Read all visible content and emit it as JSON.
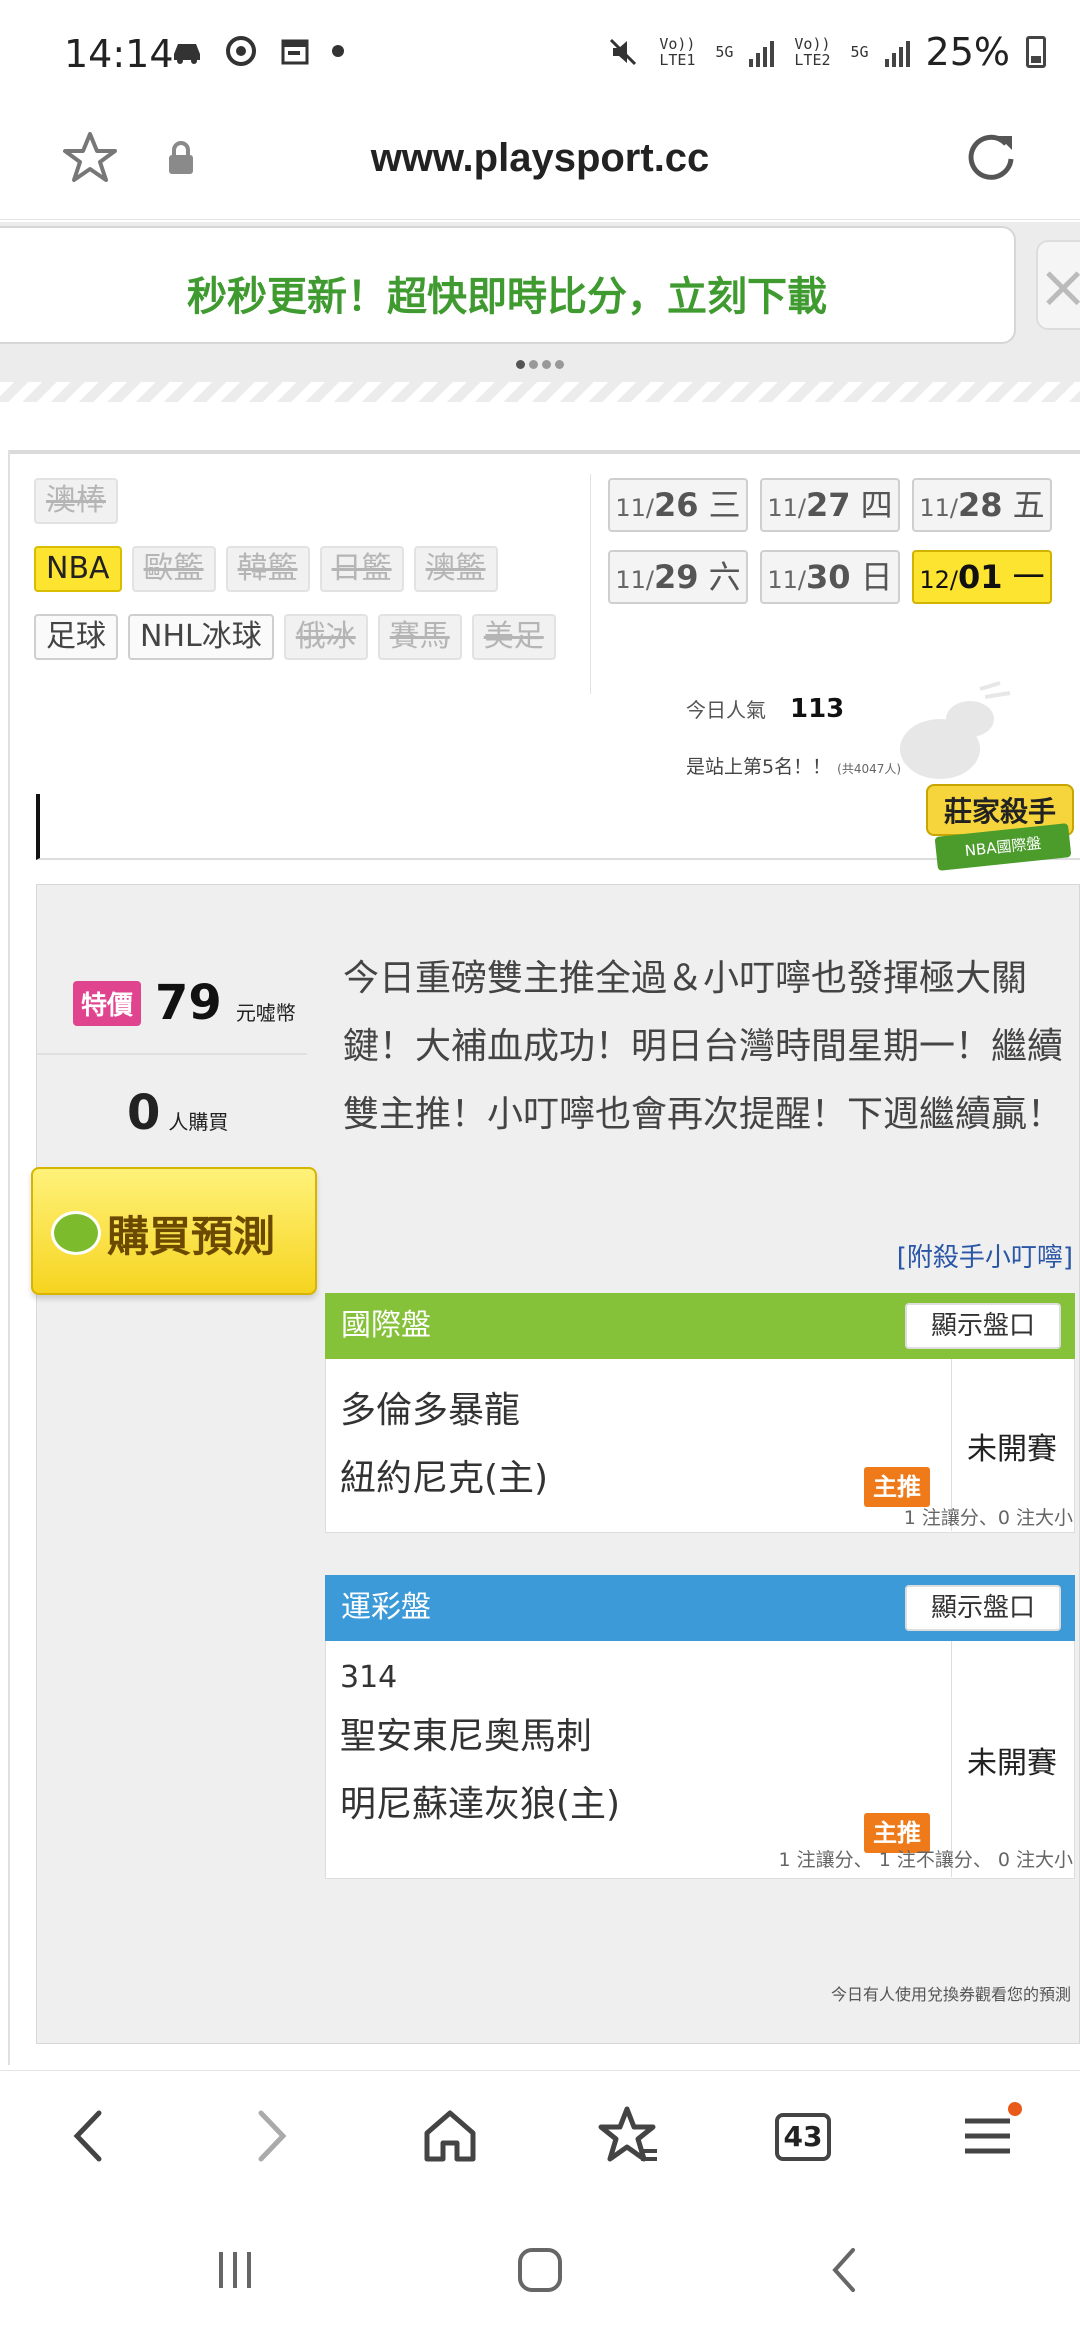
{
  "status_bar": {
    "time": "14:14",
    "lte1": "Vo)) LTE1",
    "lte2": "Vo)) LTE2",
    "net5g_1": "5G",
    "net5g_2": "5G",
    "battery": "25%"
  },
  "browser": {
    "url": "www.playsport.cc"
  },
  "banner": {
    "text": "秒秒更新！超快即時比分，立刻下載"
  },
  "sports": {
    "row1": [
      "澳棒"
    ],
    "row2": [
      "NBA",
      "歐籃",
      "韓籃",
      "日籃",
      "澳籃"
    ],
    "row3": [
      "足球",
      "NHL冰球",
      "俄冰",
      "賽馬",
      "美足"
    ]
  },
  "dates": [
    {
      "m": "11/",
      "d": "26",
      "w": "三"
    },
    {
      "m": "11/",
      "d": "27",
      "w": "四"
    },
    {
      "m": "11/",
      "d": "28",
      "w": "五"
    },
    {
      "m": "11/",
      "d": "29",
      "w": "六"
    },
    {
      "m": "11/",
      "d": "30",
      "w": "日"
    },
    {
      "m": "12/",
      "d": "01",
      "w": "一"
    }
  ],
  "popularity": {
    "label": "今日人氣",
    "value": "113",
    "rank_text": "是站上第5名！！",
    "rank_total": "(共4047人)"
  },
  "badge": {
    "title": "莊家殺手",
    "sub": "NBA國際盤"
  },
  "offer": {
    "price_tag": "特價",
    "price": "79",
    "price_unit": "元噓幣",
    "buyers": "0",
    "buyers_unit": "人購買",
    "buy_button": "購買預測"
  },
  "description": "今日重磅雙主推全過＆小叮嚀也發揮極大關鍵！大補血成功！明日台灣時間星期一！繼續雙主推！小叮嚀也會再次提醒！下週繼續贏！",
  "attach_link": "[附殺手小叮嚀]",
  "intl_box": {
    "title": "國際盤",
    "show_button": "顯示盤口",
    "team1": "多倫多暴龍",
    "team2": "紐約尼克(主)",
    "tag": "主推",
    "status": "未開賽",
    "note": "1 注讓分、0 注大小"
  },
  "lottery_box": {
    "title": "運彩盤",
    "show_button": "顯示盤口",
    "game_no": "314",
    "team1": "聖安東尼奧馬刺",
    "team2": "明尼蘇達灰狼(主)",
    "tag": "主推",
    "status": "未開賽",
    "note": "1 注讓分、 1 注不讓分、 0 注大小"
  },
  "bottom_note": "今日有人使用兌換券觀看您的預測",
  "tabs_count": "43"
}
